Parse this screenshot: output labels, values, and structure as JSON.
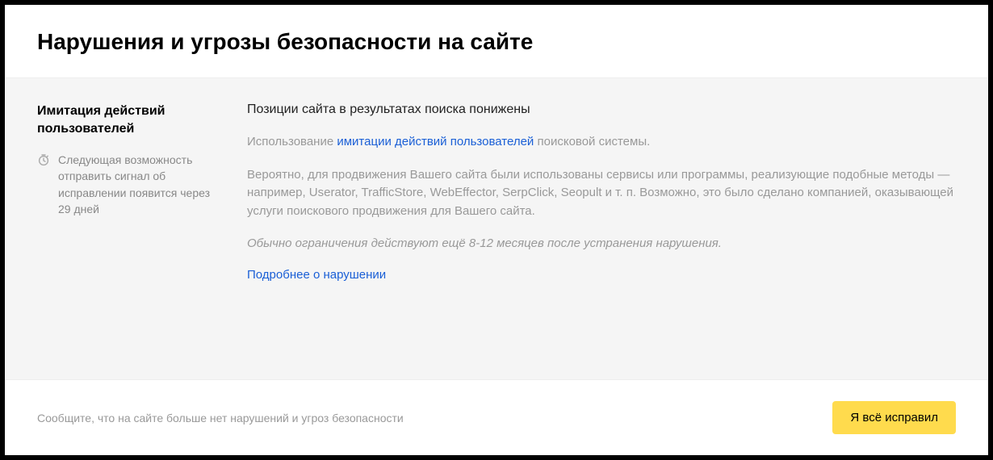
{
  "header": {
    "title": "Нарушения и угрозы безопасности на сайте"
  },
  "sidebar": {
    "violation_title": "Имитация действий пользователей",
    "timer_text": "Следующая возможность отправить сигнал об исправлении появится через 29 дней"
  },
  "main": {
    "heading": "Позиции сайта в результатах поиска понижены",
    "para1_prefix": "Использование ",
    "para1_link": "имитации действий пользователей",
    "para1_suffix": " поисковой системы.",
    "para2": "Вероятно, для продвижения Вашего сайта были использованы сервисы или программы, реализующие подобные методы — например, Userator, TrafficStore, WebEffector, SerpClick, Seopult и т. п. Возможно, это было сделано компанией, оказывающей услуги поискового продвижения для Вашего сайта.",
    "para3": "Обычно ограничения действуют ещё 8-12 месяцев после устранения нарушения.",
    "more_link": "Подробнее о нарушении"
  },
  "footer": {
    "text": "Сообщите, что на сайте больше нет нарушений и угроз безопасности",
    "button": "Я всё исправил"
  }
}
